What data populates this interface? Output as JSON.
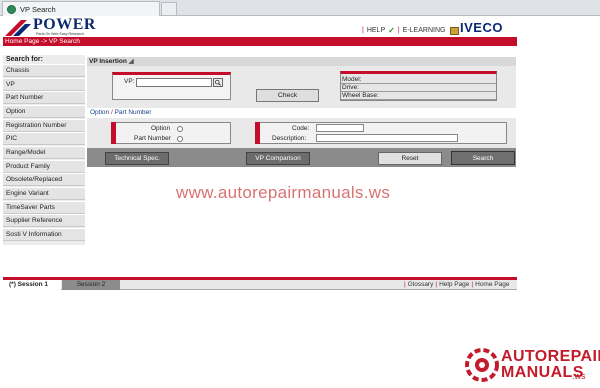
{
  "browser": {
    "tab_title": "VP Search"
  },
  "brand": {
    "name": "POWER",
    "tagline": "Parts On Web Easy Research",
    "manufacturer": "IVECO"
  },
  "top_links": {
    "help": "HELP",
    "elearning": "E-LEARNING",
    "separator": "|"
  },
  "breadcrumb": "Home Page -> VP Search",
  "sidebar": {
    "heading": "Search for:",
    "items": [
      {
        "label": "Chassis"
      },
      {
        "label": "VP"
      },
      {
        "label": "Part Number"
      },
      {
        "label": "Option"
      },
      {
        "label": "Registration Number"
      },
      {
        "label": "PIC"
      },
      {
        "label": "Range/Model"
      },
      {
        "label": "Product Family"
      },
      {
        "label": "Obsolete/Replaced"
      },
      {
        "label": "Engine Variant"
      },
      {
        "label": "TimeSaver Parts"
      },
      {
        "label": "Supplier Reference"
      },
      {
        "label": "Sosti V Information"
      }
    ]
  },
  "vp_insertion": {
    "title": "VP Insertion",
    "vp_label": "VP:",
    "vp_value": "",
    "check_label": "Check",
    "model_label": "Model:",
    "drive_label": "Drive:",
    "wheel_base_label": "Wheel Base:"
  },
  "option_part": {
    "title_option": "Option",
    "title_sep": "/",
    "title_part": "Part Number",
    "radio_option": "Option",
    "radio_part": "Part Number",
    "code_label": "Code:",
    "code_value": "",
    "description_label": "Description:",
    "description_value": ""
  },
  "actions": {
    "technical_spec": "Technical Spec.",
    "vp_comparison": "VP Comparison",
    "reset": "Reset",
    "search": "Search"
  },
  "watermark": "www.autorepairmanuals.ws",
  "sessions": {
    "session1": "(*) Session 1",
    "session2": "Session 2"
  },
  "footer_links": {
    "glossary": "Glossary",
    "help_page": "Help Page",
    "home_page": "Home Page"
  },
  "corner_logo": {
    "line1": "AUTOREPAIR",
    "line2": "MANUALS",
    "suffix": ".ws"
  },
  "colors": {
    "brand_red": "#c40d2a",
    "brand_blue": "#0a2a74"
  }
}
